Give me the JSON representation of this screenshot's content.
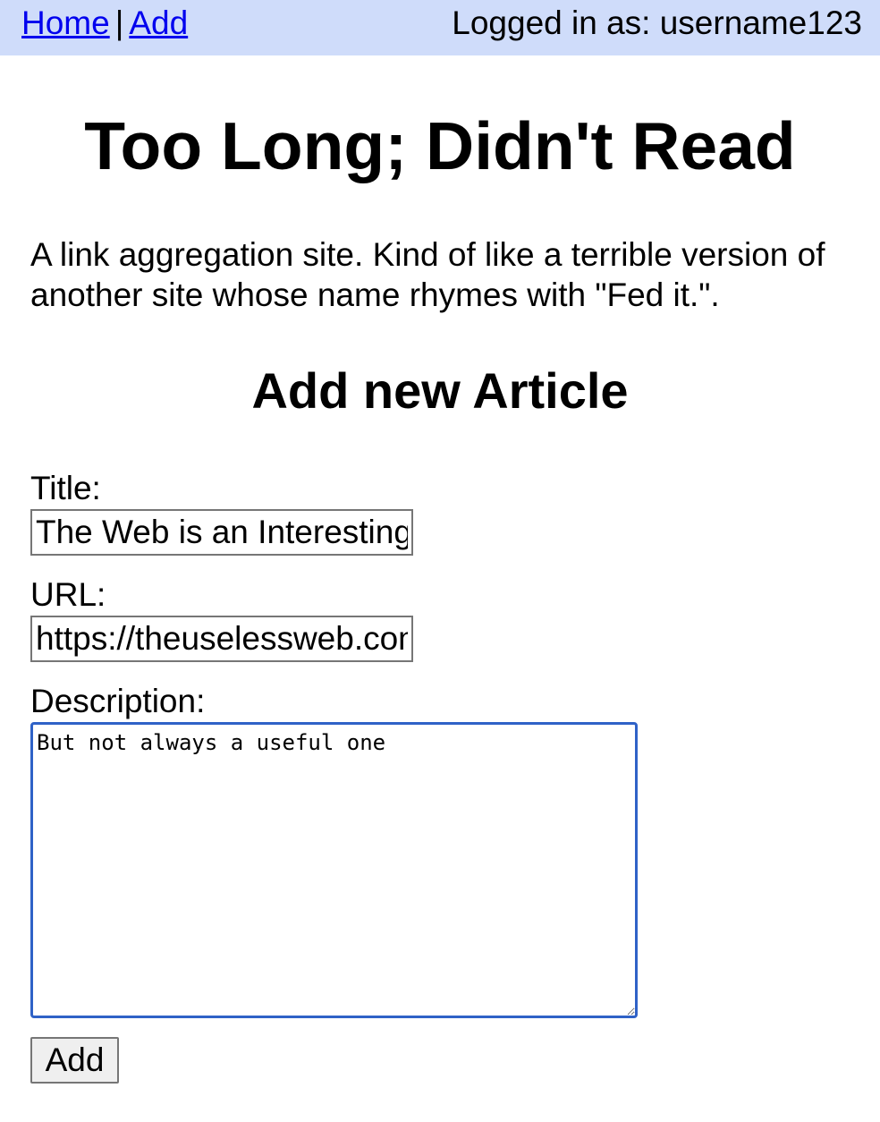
{
  "nav": {
    "home_label": "Home",
    "separator": "|",
    "add_label": "Add"
  },
  "login": {
    "text": "Logged in as: username123"
  },
  "site": {
    "title": "Too Long; Didn't Read",
    "description": "A link aggregation site. Kind of like a terrible version of another site whose name rhymes with \"Fed it.\"."
  },
  "form": {
    "heading": "Add new Article",
    "title_label": "Title:",
    "title_value": "The Web is an Interesting place",
    "url_label": "URL:",
    "url_value": "https://theuselessweb.com",
    "description_label": "Description:",
    "description_value": "But not always a useful one",
    "submit_label": "Add"
  },
  "colors": {
    "topbar_bg": "#cfdcfa",
    "link": "#0000ee",
    "focus_border": "#2f62c7"
  }
}
